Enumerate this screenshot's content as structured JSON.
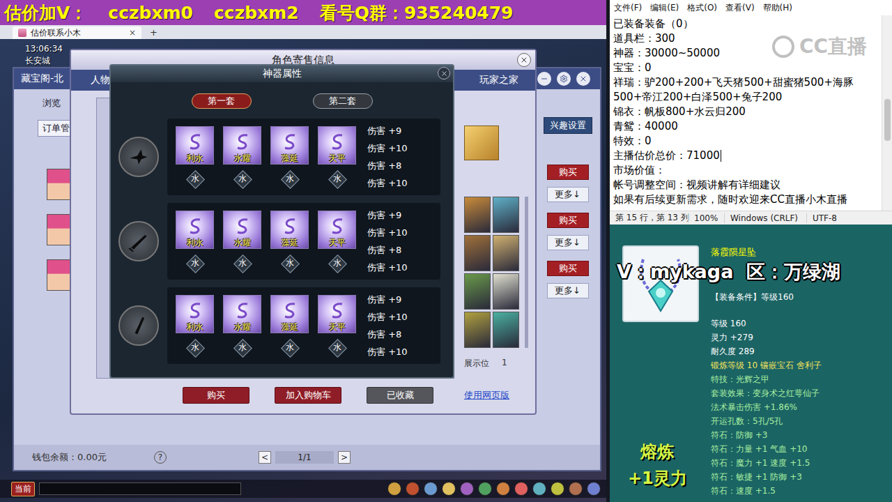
{
  "banner": {
    "parts": [
      "估价加V：",
      "cczbxm0",
      "cczbxm2",
      "看号Q群：935240479"
    ]
  },
  "browser": {
    "tabs": [
      {
        "label": "估价联系小木",
        "selected": true,
        "close": "×"
      }
    ],
    "new_tab": "+"
  },
  "hud": {
    "time": "13:06:34",
    "location": "长安城"
  },
  "market_panel": {
    "title": "藏宝阁-北",
    "nav": [
      {
        "label": "浏览",
        "selected": false
      },
      {
        "label": "订单管",
        "selected": true
      }
    ],
    "interest_button": "兴趣设置",
    "listings": [
      {
        "buy": "购买",
        "more": "更多↓"
      },
      {
        "buy": "购买",
        "more": "更多↓"
      },
      {
        "buy": "购买",
        "more": "更多↓"
      }
    ],
    "wallet": "钱包余额：0.00元",
    "help": "?",
    "pager": {
      "prev": "<",
      "page": "1/1",
      "next": ">"
    }
  },
  "sale_window": {
    "title": "角色寄售信息",
    "tab": "人物",
    "home_link": "玩家之家",
    "display_label": "展示位",
    "display_count": "1",
    "actions": [
      {
        "label": "购买",
        "kind": "primary"
      },
      {
        "label": "加入购物车",
        "kind": "primary"
      },
      {
        "label": "已收藏",
        "kind": "muted"
      }
    ],
    "web_link": "使用网页版"
  },
  "artifact_dialog": {
    "title": "神器属性",
    "sets": [
      {
        "label": "第一套",
        "selected": true
      },
      {
        "label": "第二套",
        "selected": false
      }
    ],
    "rows": [
      {
        "gems": [
          {
            "name": "利水",
            "element": "水"
          },
          {
            "name": "水耀",
            "element": "水"
          },
          {
            "name": "藻延",
            "element": "水"
          },
          {
            "name": "天平",
            "element": "水"
          }
        ],
        "stats": [
          "伤害 +9",
          "伤害 +10",
          "伤害 +8",
          "伤害 +10"
        ]
      },
      {
        "gems": [
          {
            "name": "利水",
            "element": "水"
          },
          {
            "name": "水耀",
            "element": "水"
          },
          {
            "name": "藻延",
            "element": "水"
          },
          {
            "name": "天平",
            "element": "水"
          }
        ],
        "stats": [
          "伤害 +9",
          "伤害 +10",
          "伤害 +8",
          "伤害 +10"
        ]
      },
      {
        "gems": [
          {
            "name": "利水",
            "element": "水"
          },
          {
            "name": "水耀",
            "element": "水"
          },
          {
            "name": "藻延",
            "element": "水"
          },
          {
            "name": "天平",
            "element": "水"
          }
        ],
        "stats": [
          "伤害 +9",
          "伤害 +10",
          "伤害 +8",
          "伤害 +10"
        ]
      }
    ]
  },
  "dock": {
    "channel": "当前"
  },
  "notepad": {
    "menu": [
      "文件(F)",
      "编辑(E)",
      "格式(O)",
      "查看(V)",
      "帮助(H)"
    ],
    "watermark": "CC直播",
    "lines": [
      {
        "text": "已装备装备（0）",
        "caret": false
      },
      {
        "text": "道具栏：300",
        "caret": false
      },
      {
        "text": "神器：30000~50000",
        "caret": false
      },
      {
        "text": "宝宝：0",
        "caret": false
      },
      {
        "text": "祥瑞：驴200+200+飞天猪500+甜蜜猪500+海豚",
        "caret": false
      },
      {
        "text": "500+帝江200+白泽500+兔子200",
        "caret": false
      },
      {
        "text": "锦衣：帆板800+水云归200",
        "caret": false
      },
      {
        "text": "青鸳：40000",
        "caret": false
      },
      {
        "text": "特效：0",
        "caret": false
      },
      {
        "text": "主播估价总价：71000",
        "caret": true
      },
      {
        "text": "市场价值：",
        "caret": false
      },
      {
        "text": "帐号调整空间：视频讲解有详细建议",
        "caret": false
      },
      {
        "text": "如果有后续更新需求，随时欢迎来CC直播小木直播",
        "caret": false
      }
    ],
    "status": [
      "第 15 行，第 13 列",
      "100%",
      "Windows (CRLF)",
      "UTF-8"
    ]
  },
  "item_tooltip": {
    "name": "落霞陨星坠",
    "requirement": "【装备条件】等级160",
    "stats": [
      {
        "text": "等级 160",
        "color": "#ffffff"
      },
      {
        "text": "灵力 +279",
        "color": "#ffffff"
      },
      {
        "text": "耐久度 289",
        "color": "#ffffff"
      },
      {
        "text": "锻炼等级 10 镶嵌宝石 舍利子",
        "color": "#f2e35c"
      },
      {
        "text": "特技：光辉之甲",
        "color": "#a8f0a0"
      },
      {
        "text": "套装效果：变身术之红萼仙子",
        "color": "#a8f0a0"
      },
      {
        "text": "法术暴击伤害 +1.86%",
        "color": "#a8f0a0"
      },
      {
        "text": "开运孔数：5孔/5孔",
        "color": "#a8f0a0"
      },
      {
        "text": "符石：防御 +3",
        "color": "#a8f0a0"
      },
      {
        "text": "符石：力量 +1 气血 +10",
        "color": "#a8f0a0"
      },
      {
        "text": "符石：魔力 +1 速度 +1.5",
        "color": "#a8f0a0"
      },
      {
        "text": "符石：敏捷 +1 防御 +3",
        "color": "#a8f0a0"
      },
      {
        "text": "符石：速度 +1.5",
        "color": "#a8f0a0"
      }
    ]
  },
  "overlays": {
    "contact": "V：mykaga  区：万绿湖",
    "smelt": [
      "熔炼",
      "+1灵力"
    ]
  }
}
